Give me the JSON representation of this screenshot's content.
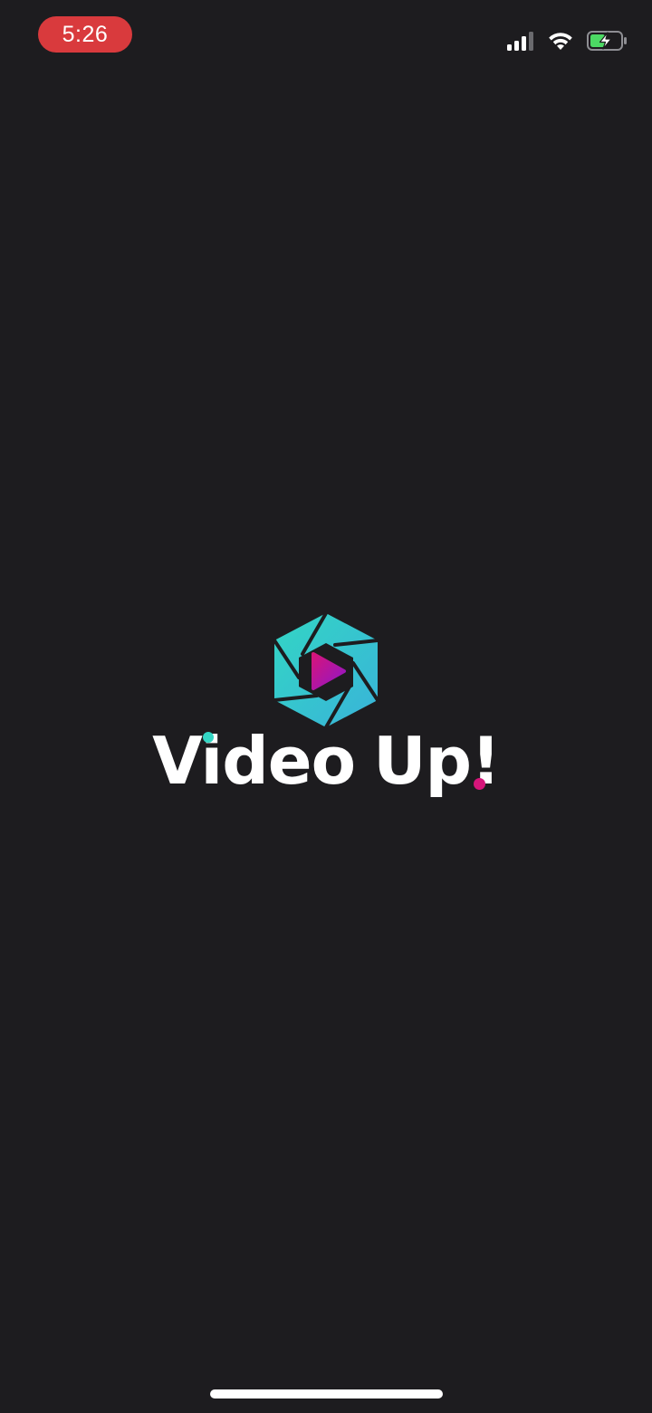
{
  "status_bar": {
    "time": "5:26",
    "time_pill_color": "#d93a3d",
    "icons": [
      "cellular-signal-icon",
      "wifi-icon",
      "battery-charging-icon"
    ],
    "battery_color": "#4cd964"
  },
  "splash": {
    "logo_icon": "aperture-play-logo-icon",
    "brand_word_1": "Video",
    "brand_word_2": "Up",
    "brand_bang": "!",
    "colors": {
      "teal": "#33d6c4",
      "cyan": "#39b3d9",
      "magenta": "#d6157a",
      "purple": "#8f16c9",
      "text": "#ffffff",
      "background": "#1d1c1f"
    }
  }
}
